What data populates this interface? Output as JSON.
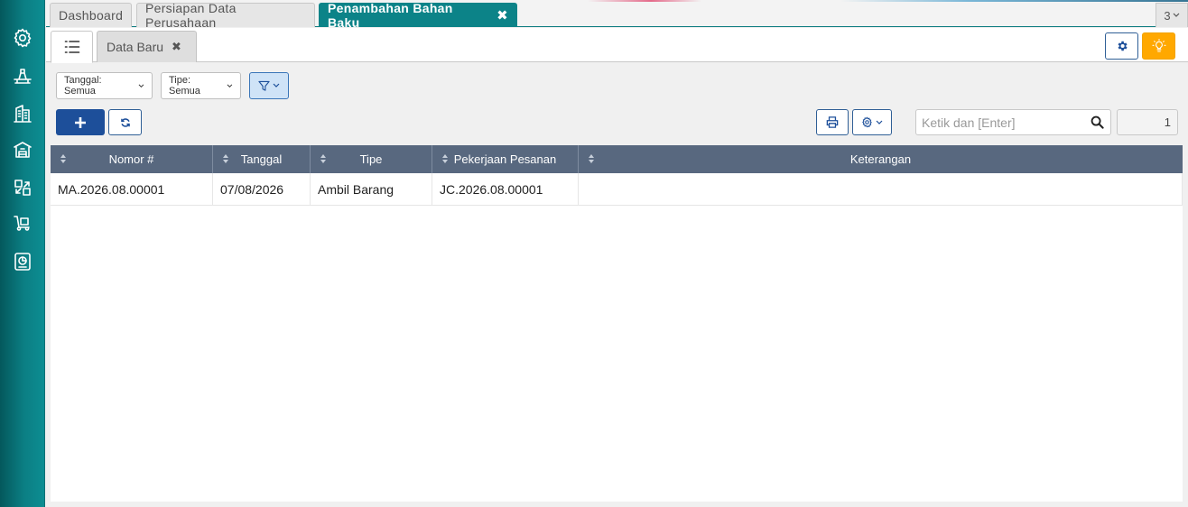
{
  "sidebar": {
    "items": [
      {
        "name": "settings",
        "icon": "gear-icon"
      },
      {
        "name": "production",
        "icon": "machine-icon"
      },
      {
        "name": "company",
        "icon": "building-icon"
      },
      {
        "name": "warehouse",
        "icon": "warehouse-icon"
      },
      {
        "name": "transfer",
        "icon": "transfer-icon"
      },
      {
        "name": "purchase",
        "icon": "cart-icon"
      },
      {
        "name": "report",
        "icon": "report-icon"
      }
    ]
  },
  "tabs": [
    {
      "label": "Dashboard",
      "active": false
    },
    {
      "label": "Persiapan Data Perusahaan",
      "active": false
    },
    {
      "label": "Penambahan Bahan Baku",
      "active": true
    }
  ],
  "tab_count": "3",
  "subtabs": {
    "list_icon": "list-icon",
    "new_label": "Data Baru"
  },
  "filters": {
    "tanggal": "Tanggal: Semua",
    "tipe": "Tipe: Semua"
  },
  "search": {
    "placeholder": "Ketik dan [Enter]"
  },
  "page": "1",
  "colors": {
    "accent": "#0c8388",
    "header": "#58687f",
    "primary": "#1d4f9a",
    "warning": "#ffa800"
  },
  "table": {
    "columns": [
      "Nomor #",
      "Tanggal",
      "Tipe",
      "Pekerjaan Pesanan",
      "Keterangan"
    ],
    "rows": [
      [
        "MA.2026.08.00001",
        "07/08/2026",
        "Ambil Barang",
        "JC.2026.08.00001",
        ""
      ]
    ]
  }
}
